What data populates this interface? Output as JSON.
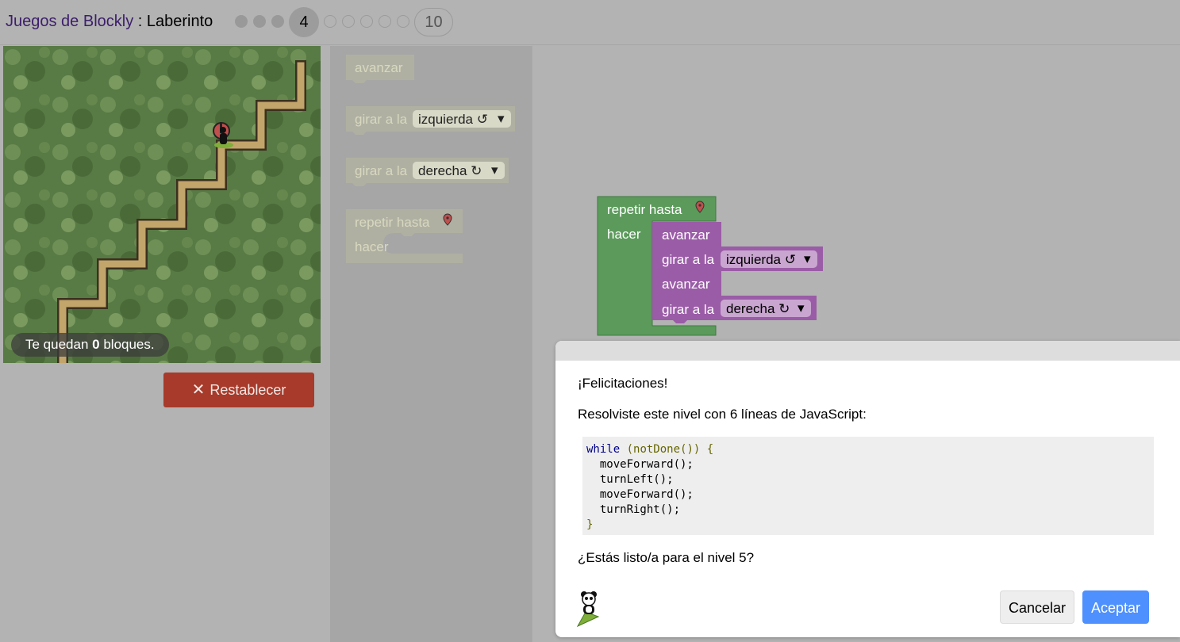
{
  "header": {
    "app_link": "Juegos de Blockly",
    "separator": " : ",
    "game_name": "Laberinto",
    "current_level": "4",
    "last_level": "10",
    "levels_done": 3,
    "levels_todo": 5
  },
  "maze": {
    "remaining_prefix": "Te quedan ",
    "remaining_count": "0",
    "remaining_suffix": " bloques."
  },
  "reset_button": {
    "icon": "✕",
    "label": "Restablecer"
  },
  "toolbox": {
    "move_forward": "avanzar",
    "turn_prefix": "girar a la",
    "turn_left": "izquierda ↺",
    "turn_right": "derecha ↻",
    "dropdown_arrow": "▾",
    "repeat_until": "repetir hasta",
    "do_label": "hacer"
  },
  "workspace": {
    "repeat_until": "repetir hasta",
    "do_label": "hacer",
    "stmt1": "avanzar",
    "stmt2_prefix": "girar a la",
    "stmt2_value": "izquierda ↺",
    "stmt3": "avanzar",
    "stmt4_prefix": "girar a la",
    "stmt4_value": "derecha ↻",
    "dropdown_arrow": "▾"
  },
  "dialog": {
    "congrats": "¡Felicitaciones!",
    "lines_text": "Resolviste este nivel con 6 líneas de JavaScript:",
    "code": {
      "l1_kw": "while",
      "l1_rest": " (notDone()) {",
      "l2": "  moveForward();",
      "l3": "  turnLeft();",
      "l4": "  moveForward();",
      "l5": "  turnRight();",
      "l6": "}"
    },
    "next_question": "¿Estás listo/a para el nivel 5?",
    "cancel_label": "Cancelar",
    "ok_label": "Aceptar"
  },
  "colors": {
    "loop_block": "#5b9a5b",
    "move_block": "#9a5ca6",
    "reset": "#a73a2a",
    "ok": "#4d90fe",
    "title_link": "#3c1e6b"
  }
}
